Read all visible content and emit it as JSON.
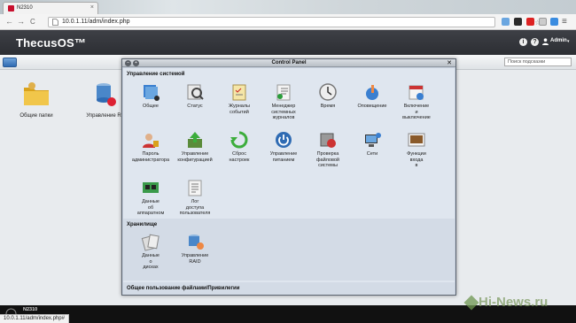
{
  "browser": {
    "tab_title": "N2310",
    "tab_close": "×",
    "back": "←",
    "forward": "→",
    "reload": "C",
    "url": "10.0.1.11/adm/index.php",
    "star": "☆",
    "menu": "≡",
    "status_url": "10.0.1.11/adm/index.php#"
  },
  "header": {
    "brand": "ThecusOS™",
    "info_icon": "i",
    "help_icon": "?",
    "user_label": "Admin"
  },
  "toolbar": {
    "search_placeholder": "Поиск подсказки"
  },
  "desktop": {
    "items": [
      {
        "label": "Общие папки"
      },
      {
        "label": "Управление R"
      }
    ]
  },
  "control_panel": {
    "title": "Control Panel",
    "sections": [
      {
        "title": "Управление системой",
        "items": [
          {
            "label": "Общее",
            "icon": "general-icon"
          },
          {
            "label": "Статус",
            "icon": "status-icon"
          },
          {
            "label": "Журналы\nсобытий",
            "icon": "event-log-icon"
          },
          {
            "label": "Менеджер\nсистемных\nжурналов",
            "icon": "syslog-manager-icon"
          },
          {
            "label": "Время",
            "icon": "clock-icon"
          },
          {
            "label": "Оповещение",
            "icon": "notification-icon"
          },
          {
            "label": "Включение\nи\nвыключение",
            "icon": "power-schedule-icon"
          },
          {
            "label": "Пароль\nадминистратора",
            "icon": "admin-password-icon"
          },
          {
            "label": "Управление\nконфигурацией",
            "icon": "config-management-icon"
          },
          {
            "label": "Сброс\nнастроек",
            "icon": "reset-icon"
          },
          {
            "label": "Управление\nпитанием",
            "icon": "power-management-icon"
          },
          {
            "label": "Проверка\nфайловой\nсистемы",
            "icon": "filesystem-check-icon"
          },
          {
            "label": "Сети",
            "icon": "network-icon"
          },
          {
            "label": "Функции\nвхода\nв",
            "icon": "login-options-icon"
          },
          {
            "label": "Данные\nоб\nаппаратном",
            "icon": "hardware-info-icon"
          },
          {
            "label": "Лог\nдоступа\nпользователя",
            "icon": "user-access-log-icon"
          }
        ]
      },
      {
        "title": "Хранилище",
        "items": [
          {
            "label": "Данные\nо\nдисках",
            "icon": "disk-info-icon"
          },
          {
            "label": "Управление\nRAID",
            "icon": "raid-management-icon"
          }
        ]
      },
      {
        "title": "Общее пользование файлами/Привилегии",
        "items": []
      }
    ]
  },
  "taskbar": {
    "item": "N2310"
  },
  "watermark": "Hi-News.ru",
  "colors": {
    "header_bg": "#2c2e33",
    "panel_bg": "#dfe6ef",
    "accent": "#2f6bb3"
  }
}
